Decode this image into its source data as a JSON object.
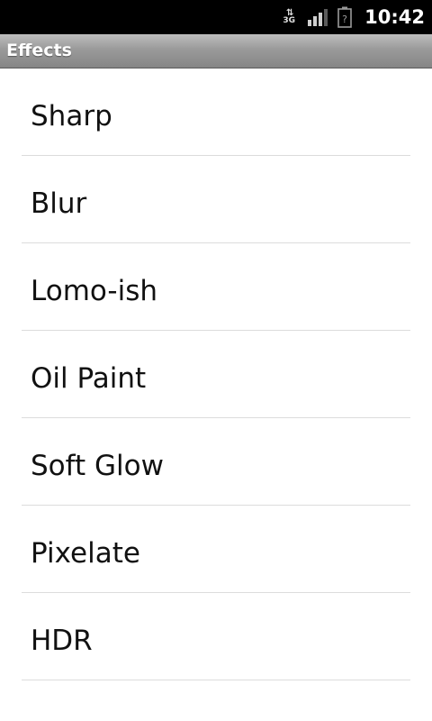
{
  "status_bar": {
    "network_type": "3G",
    "clock": "10:42",
    "icons": [
      "data-transfer-icon",
      "signal-strength-icon",
      "battery-unknown-icon"
    ]
  },
  "title_bar": {
    "title": "Effects"
  },
  "effects": [
    {
      "label": "Sharp"
    },
    {
      "label": "Blur"
    },
    {
      "label": "Lomo-ish"
    },
    {
      "label": "Oil Paint"
    },
    {
      "label": "Soft Glow"
    },
    {
      "label": "Pixelate"
    },
    {
      "label": "HDR"
    }
  ],
  "colors": {
    "status_bar_bg": "#000000",
    "title_bar_bg": "#9a9a9a",
    "list_bg": "#ffffff",
    "item_text": "#111111",
    "divider": "#dcdcdc"
  }
}
